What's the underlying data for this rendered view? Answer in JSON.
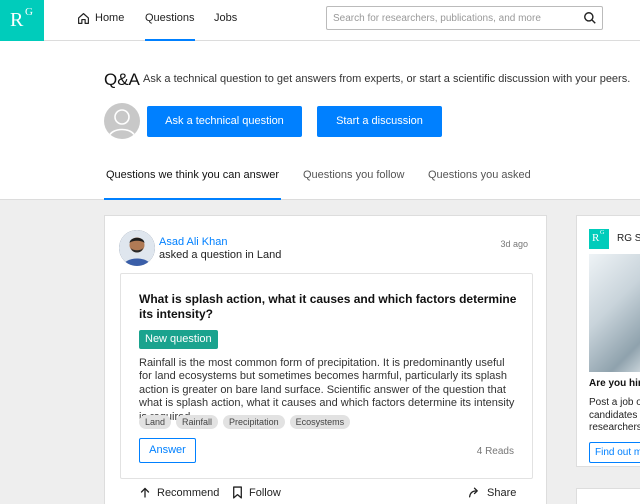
{
  "topnav": {
    "logo": {
      "r": "R",
      "g": "G"
    },
    "items": [
      {
        "label": "Home",
        "icon": "home-icon"
      },
      {
        "label": "Questions"
      },
      {
        "label": "Jobs"
      }
    ],
    "search": {
      "placeholder": "Search for researchers, publications, and more",
      "value": "",
      "icon": "search-icon"
    }
  },
  "header": {
    "title": "Q&A",
    "subtitle": "Ask a technical question to get answers from experts, or start a scientific discussion with your peers.",
    "ask_button": "Ask a technical question",
    "discussion_button": "Start a discussion",
    "tabs": [
      {
        "label": "Questions we think you can answer",
        "active": true
      },
      {
        "label": "Questions you follow",
        "active": false
      },
      {
        "label": "Questions you asked",
        "active": false
      }
    ]
  },
  "question_card": {
    "author": "Asad Ali Khan",
    "action": "asked a question in Land",
    "time": "3d ago",
    "title": "What is splash action, what it causes and which factors determine its intensity?",
    "badge": "New question",
    "body": "Rainfall is the most common form of precipitation. It is predominantly useful for land ecosystems but sometimes becomes harmful, particularly its splash action is greater on bare land surface. Scientific answer of the question that what is splash action, what it causes and which factors determine its intensity is required.",
    "tags": [
      "Land",
      "Rainfall",
      "Precipitation",
      "Ecosystems"
    ],
    "answer_button": "Answer",
    "reads": "4 Reads",
    "actions": {
      "recommend": "Recommend",
      "follow": "Follow",
      "share": "Share"
    }
  },
  "side_card": {
    "name": "RG Sc",
    "heading": "Are you hiri",
    "text_lines": [
      "Post a job o",
      "candidates",
      "researchers"
    ],
    "button": "Find out m"
  },
  "colors": {
    "brand": "#00ccbb",
    "accent": "#0080ff",
    "badge": "#1aa38e"
  }
}
